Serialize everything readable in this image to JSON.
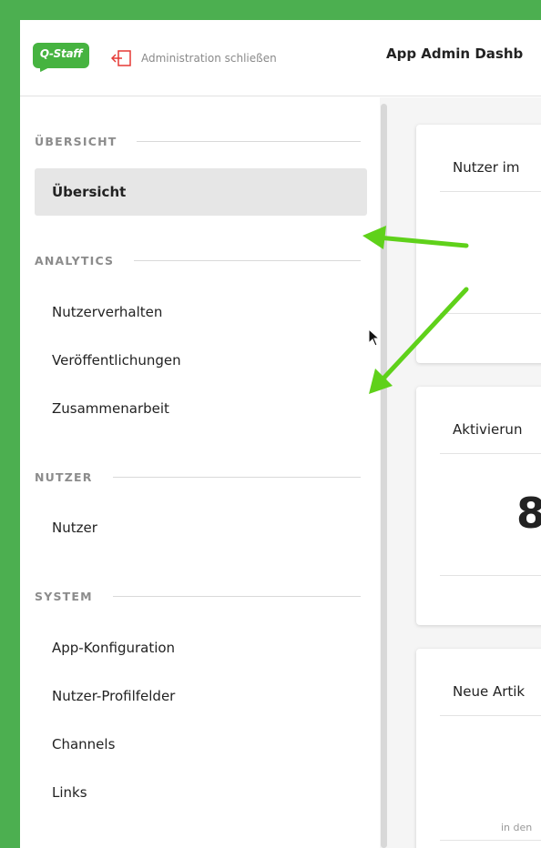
{
  "header": {
    "logo_text": "Q-Staff",
    "close_admin_label": "Administration schließen",
    "page_title": "App Admin Dashb",
    "colors": {
      "brand": "#46b340",
      "frame": "#4caf50",
      "close_icon": "#e53935"
    }
  },
  "sidebar": {
    "sections": [
      {
        "title": "ÜBERSICHT",
        "items": [
          {
            "label": "Übersicht",
            "active": true
          }
        ]
      },
      {
        "title": "ANALYTICS",
        "items": [
          {
            "label": "Nutzerverhalten"
          },
          {
            "label": "Veröffentlichungen"
          },
          {
            "label": "Zusammenarbeit"
          }
        ]
      },
      {
        "title": "NUTZER",
        "items": [
          {
            "label": "Nutzer"
          }
        ]
      },
      {
        "title": "SYSTEM",
        "items": [
          {
            "label": "App-Konfiguration"
          },
          {
            "label": "Nutzer-Profilfelder"
          },
          {
            "label": "Channels"
          },
          {
            "label": "Links"
          }
        ]
      }
    ]
  },
  "main": {
    "cards": [
      {
        "title": "Nutzer im"
      },
      {
        "title": "Aktivierun",
        "value": "8"
      },
      {
        "title": "Neue Artik",
        "footer": "in den"
      }
    ]
  },
  "annotations": {
    "arrow_color": "#5fd11a"
  }
}
